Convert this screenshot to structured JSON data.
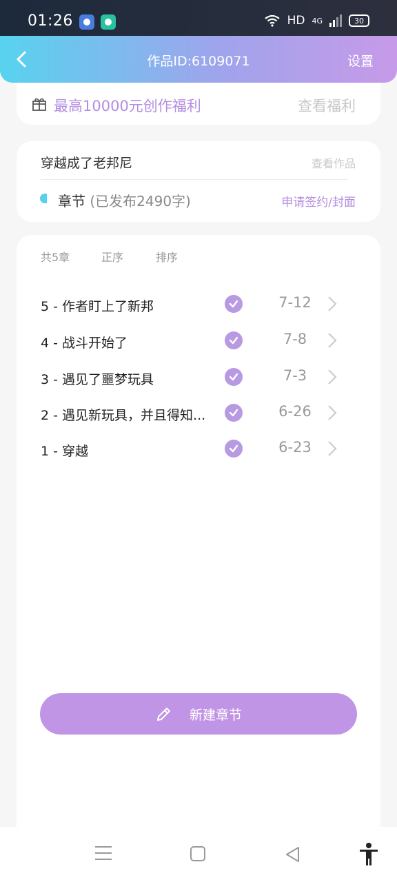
{
  "status_bar": {
    "time": "01:26",
    "network": "HD",
    "signal_label": "4G",
    "battery": "30"
  },
  "nav": {
    "title": "作品ID:6109071",
    "settings_label": "设置"
  },
  "welfare": {
    "text": "最高10000元创作福利",
    "link": "查看福利"
  },
  "work": {
    "title": "穿越成了老邦尼",
    "view_link": "查看作品",
    "chapter_label": "章节",
    "chapter_count": "(已发布2490字)",
    "sign_link": "申请签约/封面"
  },
  "toolbar": {
    "count": "共5章",
    "order": "正序",
    "sort": "排序"
  },
  "chapters": [
    {
      "title": "5 - 作者盯上了新邦",
      "date": "7-12",
      "published": true
    },
    {
      "title": "4 - 战斗开始了",
      "date": "7-8",
      "published": true
    },
    {
      "title": "3 - 遇见了噩梦玩具",
      "date": "7-3",
      "published": true
    },
    {
      "title": "2 - 遇见新玩具，并且得知...",
      "date": "6-26",
      "published": true
    },
    {
      "title": "1 - 穿越",
      "date": "6-23",
      "published": true
    }
  ],
  "new_chapter_button": "新建章节",
  "colors": {
    "accent": "#c195e6",
    "header_start": "#57d3ef",
    "header_end": "#c79ae8"
  }
}
